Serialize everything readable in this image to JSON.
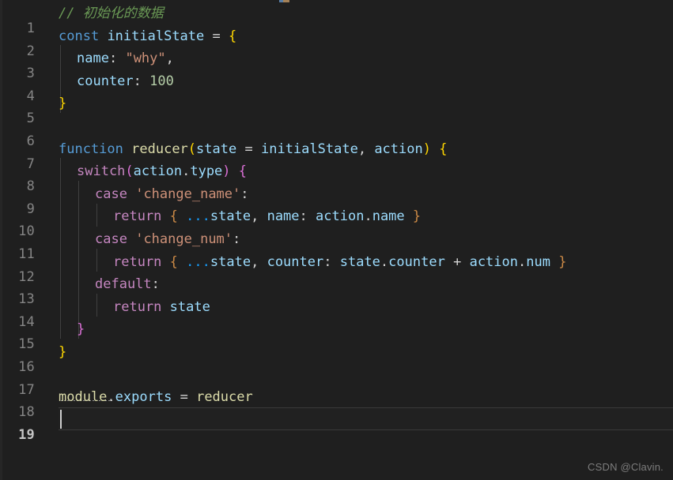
{
  "editor": {
    "theme": "dark-plus",
    "background_color": "#1f1f1f",
    "gutter_color": "#858585",
    "active_line_number": 19,
    "total_lines": 19,
    "cursor_line": 19,
    "cursor_column": 1,
    "language": "javascript",
    "colors": {
      "comment": "#6A9955",
      "keyword": "#569CD6",
      "control_keyword": "#C586C0",
      "variable": "#9CDCFE",
      "function": "#DCDCAA",
      "string": "#CE9178",
      "number": "#B5CEA8",
      "plain": "#D4D4D4",
      "bracket_level1": "#FFD700",
      "bracket_level2": "#DA70D6",
      "bracket_level3": "#179FFF",
      "indent_guide": "#404040"
    }
  },
  "line_numbers": [
    "1",
    "2",
    "3",
    "4",
    "5",
    "6",
    "7",
    "8",
    "9",
    "10",
    "11",
    "12",
    "13",
    "14",
    "15",
    "16",
    "17",
    "18",
    "19"
  ],
  "code_lines": [
    "// 初始化的数据",
    "const initialState = {",
    "  name: \"why\",",
    "  counter: 100",
    "}",
    "",
    "function reducer(state = initialState, action) {",
    "  switch(action.type) {",
    "    case 'change_name':",
    "      return { ...state, name: action.name }",
    "    case 'change_num':",
    "      return { ...state, counter: state.counter + action.num }",
    "    default:",
    "      return state",
    "  }",
    "}",
    "",
    "module.exports = reducer",
    ""
  ],
  "tokens": {
    "l1_comment": "// 初始化的数据",
    "l2_const": "const",
    "l2_initialState": "initialState",
    "l2_eq": "=",
    "l2_brace": "{",
    "l3_name": "name",
    "l3_colon": ":",
    "l3_string": "\"why\"",
    "l3_comma": ",",
    "l4_counter": "counter",
    "l4_colon": ":",
    "l4_number": "100",
    "l5_brace": "}",
    "l7_function": "function",
    "l7_reducer": "reducer",
    "l7_paren_open": "(",
    "l7_state": "state",
    "l7_eq": "=",
    "l7_initialState": "initialState",
    "l7_comma": ",",
    "l7_action": "action",
    "l7_paren_close": ")",
    "l7_brace": "{",
    "l8_switch": "switch",
    "l8_paren_open": "(",
    "l8_action": "action",
    "l8_dot": ".",
    "l8_type": "type",
    "l8_paren_close": ")",
    "l8_brace": "{",
    "l9_case": "case",
    "l9_string": "'change_name'",
    "l9_colon": ":",
    "l10_return": "return",
    "l10_brace_open": "{",
    "l10_spread": "...",
    "l10_state": "state",
    "l10_comma": ",",
    "l10_name": "name",
    "l10_colon": ":",
    "l10_action": "action",
    "l10_dot": ".",
    "l10_nameprop": "name",
    "l10_brace_close": "}",
    "l11_case": "case",
    "l11_string": "'change_num'",
    "l11_colon": ":",
    "l12_return": "return",
    "l12_brace_open": "{",
    "l12_spread": "...",
    "l12_state": "state",
    "l12_comma": ",",
    "l12_counter": "counter",
    "l12_colon": ":",
    "l12_state2": "state",
    "l12_dot1": ".",
    "l12_counterprop": "counter",
    "l12_plus": "+",
    "l12_action": "action",
    "l12_dot2": ".",
    "l12_numprop": "num",
    "l12_brace_close": "}",
    "l13_default": "default",
    "l13_colon": ":",
    "l14_return": "return",
    "l14_state": "state",
    "l15_brace": "}",
    "l16_brace": "}",
    "l18_module": "module",
    "l18_dot": ".",
    "l18_exports": "exports",
    "l18_eq": "=",
    "l18_reducer": "reducer"
  },
  "watermark": {
    "text": "CSDN @Clavin."
  }
}
